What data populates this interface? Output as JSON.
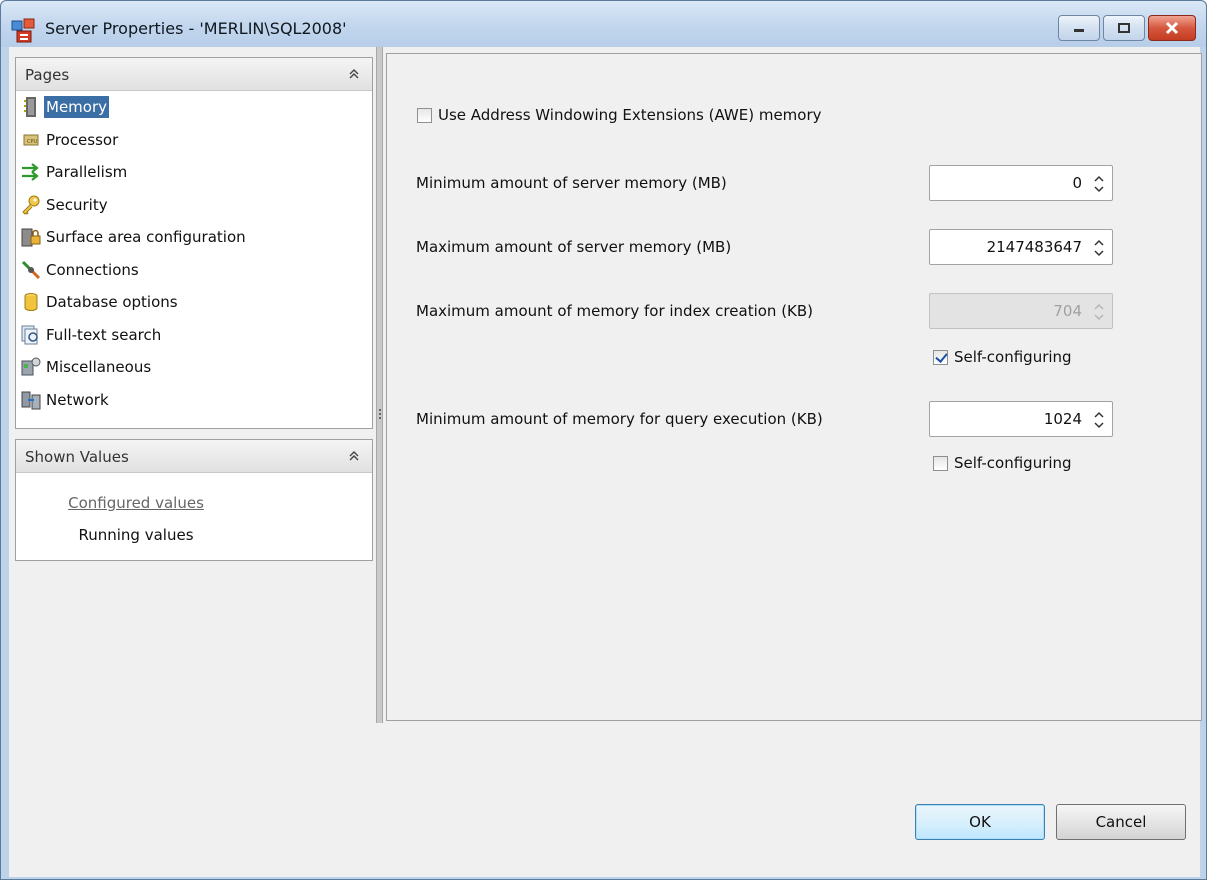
{
  "window": {
    "title": "Server Properties - 'MERLIN\\SQL2008'",
    "controls": [
      "minimize-icon",
      "restore-icon",
      "close-icon"
    ]
  },
  "pages_panel": {
    "header": "Pages",
    "items": [
      {
        "label": "Memory",
        "icon": "memory-chip-icon",
        "selected": true
      },
      {
        "label": "Processor",
        "icon": "cpu-icon"
      },
      {
        "label": "Parallelism",
        "icon": "parallel-arrows-icon"
      },
      {
        "label": "Security",
        "icon": "key-icon"
      },
      {
        "label": "Surface area configuration",
        "icon": "lock-server-icon"
      },
      {
        "label": "Connections",
        "icon": "plug-icon"
      },
      {
        "label": "Database options",
        "icon": "database-icon"
      },
      {
        "label": "Full-text search",
        "icon": "search-docs-icon"
      },
      {
        "label": "Miscellaneous",
        "icon": "misc-icon"
      },
      {
        "label": "Network",
        "icon": "network-icon"
      }
    ]
  },
  "shown_values_panel": {
    "header": "Shown Values",
    "items": [
      {
        "label": "Configured values",
        "active": true
      },
      {
        "label": "Running values"
      }
    ]
  },
  "memory": {
    "awe_label": "Use Address Windowing Extensions (AWE) memory",
    "awe_checked": false,
    "min_server_label": "Minimum amount of server memory (MB)",
    "min_server_value": "0",
    "max_server_label": "Maximum amount of server memory (MB)",
    "max_server_value": "2147483647",
    "index_label": "Maximum amount of memory for index creation (KB)",
    "index_value": "704",
    "index_self_label": "Self-configuring",
    "index_self_checked": true,
    "query_label": "Minimum amount of memory for query execution (KB)",
    "query_value": "1024",
    "query_self_label": "Self-configuring",
    "query_self_checked": false
  },
  "buttons": {
    "ok": "OK",
    "cancel": "Cancel"
  },
  "colors": {
    "selection": "#3a6ea5",
    "window_frame": "#bcd3ea",
    "close_button": "#c43d22"
  }
}
